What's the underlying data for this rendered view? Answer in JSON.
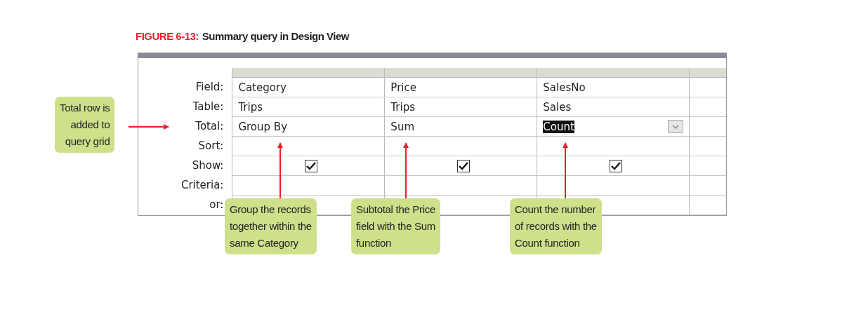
{
  "figure": {
    "label": "FIGURE 6-13:",
    "title": "Summary query in Design View"
  },
  "row_labels": [
    "Field:",
    "Table:",
    "Total:",
    "Sort:",
    "Show:",
    "Criteria:",
    "or:"
  ],
  "columns": [
    {
      "field": "Category",
      "table": "Trips",
      "total": "Group By",
      "total_selected": false,
      "show": true
    },
    {
      "field": "Price",
      "table": "Trips",
      "total": "Sum",
      "total_selected": false,
      "show": true
    },
    {
      "field": "SalesNo",
      "table": "Sales",
      "total": "Count",
      "total_selected": true,
      "show": true
    }
  ],
  "callouts": [
    {
      "kind": "left",
      "text": "Total row is\nadded to\nquery grid"
    },
    {
      "kind": "below",
      "text": "Group the records\ntogether within the\nsame Category"
    },
    {
      "kind": "below",
      "text": "Subtotal the Price\nfield with the Sum\nfunction"
    },
    {
      "kind": "below",
      "text": "Count the number\nof records with the\nCount function"
    }
  ]
}
